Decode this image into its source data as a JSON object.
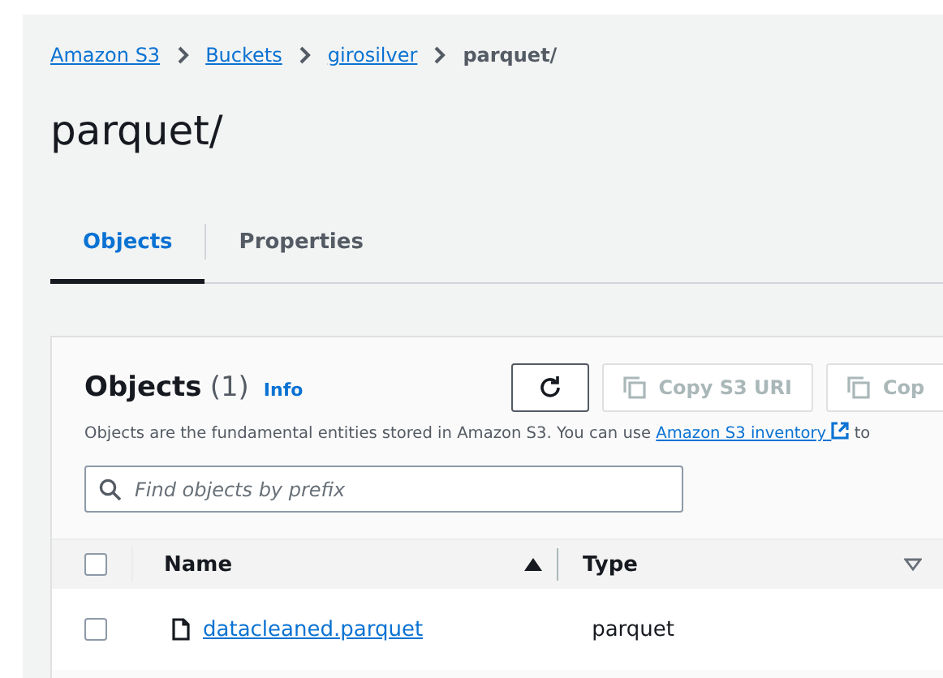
{
  "breadcrumbs": [
    {
      "label": "Amazon S3",
      "link": true
    },
    {
      "label": "Buckets",
      "link": true
    },
    {
      "label": "girosilver",
      "link": true
    },
    {
      "label": "parquet/",
      "link": false
    }
  ],
  "title": "parquet/",
  "tabs": [
    {
      "label": "Objects",
      "selected": true
    },
    {
      "label": "Properties",
      "selected": false
    }
  ],
  "objects_panel": {
    "title": "Objects",
    "count": "(1)",
    "info": "Info",
    "buttons": [
      {
        "kind": "refresh"
      },
      {
        "kind": "copy",
        "label": "Copy S3 URI"
      },
      {
        "kind": "copy",
        "label": "Cop"
      }
    ],
    "description": "Objects are the fundamental entities stored in Amazon S3. You can use",
    "description_link": "Amazon S3 inventory",
    "description_tail": "to",
    "search": {
      "placeholder": "Find objects by prefix"
    },
    "table": {
      "select_all_checked": false,
      "columns": [
        {
          "label": "Name",
          "sorted": true
        },
        {
          "label": "Type",
          "sorted": false
        }
      ],
      "rows": [
        {
          "checked": false,
          "name": "datacleaned.parquet",
          "type": "parquet"
        }
      ]
    }
  }
}
